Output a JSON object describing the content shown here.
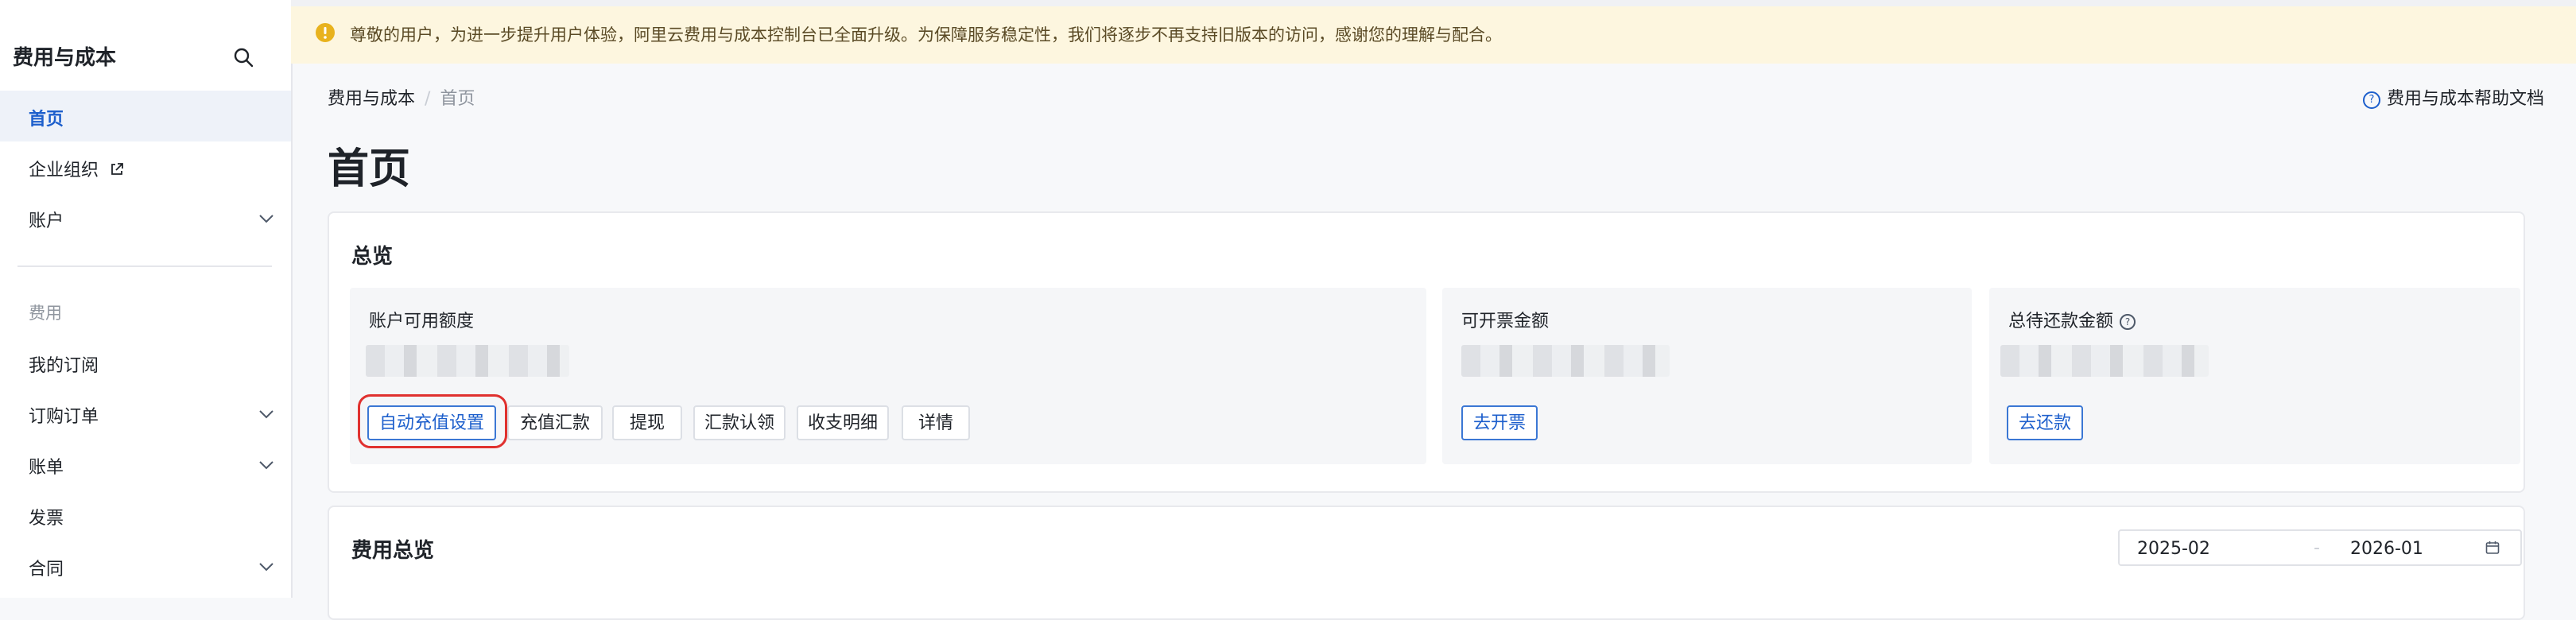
{
  "sidebar": {
    "title": "费用与成本",
    "search_icon": "search-icon",
    "items": [
      {
        "label": "首页",
        "active": true
      },
      {
        "label": "企业组织",
        "external": true
      },
      {
        "label": "账户",
        "expandable": true
      }
    ],
    "group_label": "费用",
    "group_items": [
      {
        "label": "我的订阅"
      },
      {
        "label": "订购订单",
        "expandable": true
      },
      {
        "label": "账单",
        "expandable": true
      },
      {
        "label": "发票"
      },
      {
        "label": "合同",
        "expandable": true
      }
    ]
  },
  "notice": {
    "icon": "warning-icon",
    "text": "尊敬的用户，为进一步提升用户体验，阿里云费用与成本控制台已全面升级。为保障服务稳定性，我们将逐步不再支持旧版本的访问，感谢您的理解与配合。"
  },
  "breadcrumb": [
    "费用与成本",
    "首页"
  ],
  "help_link": "费用与成本帮助文档",
  "page_title": "首页",
  "overview": {
    "title": "总览",
    "account_card": {
      "title": "账户可用额度",
      "buttons": [
        "自动充值设置",
        "充值汇款",
        "提现",
        "汇款认领",
        "收支明细",
        "详情"
      ]
    },
    "invoice_card": {
      "title": "可开票金额",
      "button": "去开票"
    },
    "repay_card": {
      "title": "总待还款金额",
      "button": "去还款"
    }
  },
  "cost_overview": {
    "title": "费用总览",
    "date_start": "2025-02",
    "date_separator": "-",
    "date_end": "2026-01"
  },
  "colors": {
    "accent": "#1d5fcc",
    "highlight_ring": "#e0312f",
    "notice_bg": "#fdf6df"
  }
}
